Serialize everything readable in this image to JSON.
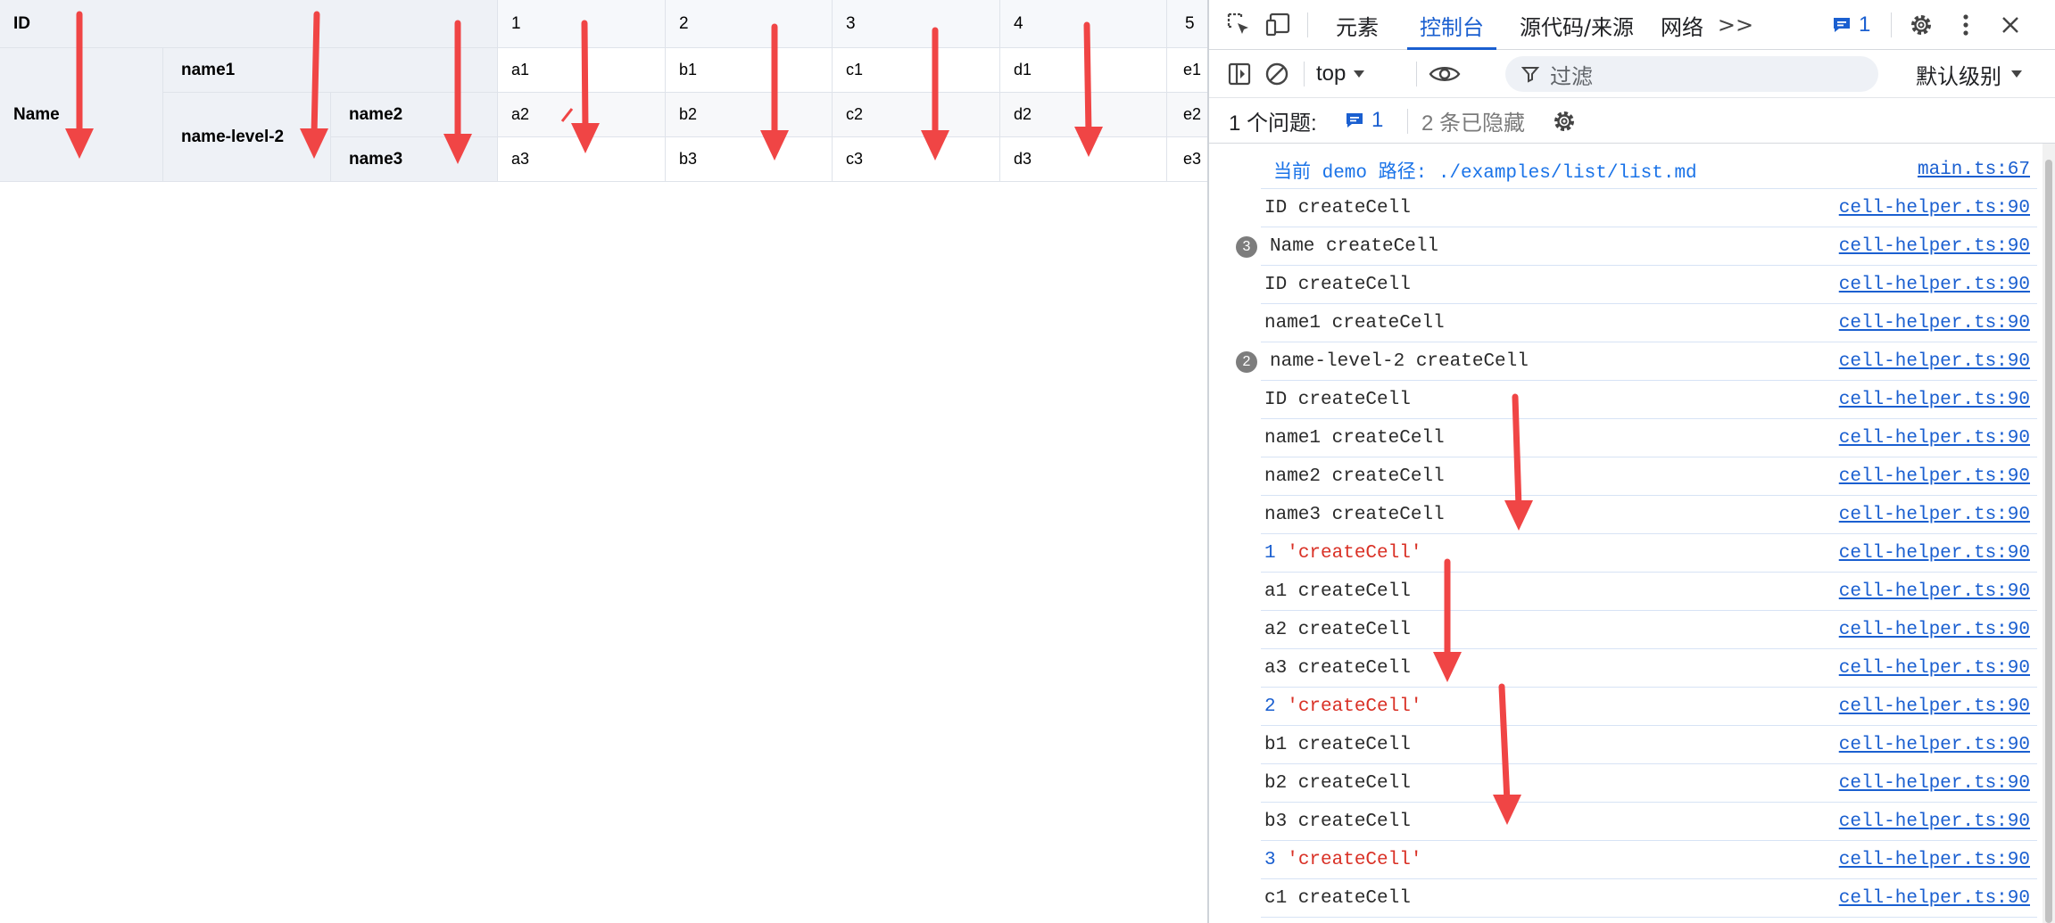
{
  "table": {
    "header_id": "ID",
    "row_header_name": "Name",
    "row_header_name1": "name1",
    "row_header_level2": "name-level-2",
    "row_header_name2": "name2",
    "row_header_name3": "name3",
    "columns": [
      "1",
      "2",
      "3",
      "4",
      "5"
    ],
    "rows": [
      [
        "a1",
        "b1",
        "c1",
        "d1",
        "e1"
      ],
      [
        "a2",
        "b2",
        "c2",
        "d2",
        "e2"
      ],
      [
        "a3",
        "b3",
        "c3",
        "d3",
        "e3"
      ]
    ]
  },
  "devtools": {
    "tabs": [
      "元素",
      "控制台",
      "源代码/来源",
      "网络"
    ],
    "active_tab": "控制台",
    "more_tabs": ">>",
    "messages_count": "1",
    "context": "top",
    "filter_placeholder": "过滤",
    "levels": "默认级别",
    "issues_label": "1 个问题:",
    "issues_count": "1",
    "hidden_label": "2 条已隐藏"
  },
  "console": [
    {
      "msg": "当前 demo 路径: ./examples/list/list.md",
      "src": "main.ts:67",
      "style": "info"
    },
    {
      "msg": "ID createCell",
      "src": "cell-helper.ts:90"
    },
    {
      "msg": "Name createCell",
      "src": "cell-helper.ts:90",
      "badge": "3"
    },
    {
      "msg": "ID createCell",
      "src": "cell-helper.ts:90"
    },
    {
      "msg": "name1 createCell",
      "src": "cell-helper.ts:90"
    },
    {
      "msg": "name-level-2 createCell",
      "src": "cell-helper.ts:90",
      "badge": "2"
    },
    {
      "msg": "ID createCell",
      "src": "cell-helper.ts:90"
    },
    {
      "msg": "name1 createCell",
      "src": "cell-helper.ts:90"
    },
    {
      "msg": "name2 createCell",
      "src": "cell-helper.ts:90"
    },
    {
      "msg": "name3 createCell",
      "src": "cell-helper.ts:90"
    },
    {
      "num": "1",
      "str": "'createCell'",
      "src": "cell-helper.ts:90"
    },
    {
      "msg": "a1 createCell",
      "src": "cell-helper.ts:90"
    },
    {
      "msg": "a2 createCell",
      "src": "cell-helper.ts:90"
    },
    {
      "msg": "a3 createCell",
      "src": "cell-helper.ts:90"
    },
    {
      "num": "2",
      "str": "'createCell'",
      "src": "cell-helper.ts:90"
    },
    {
      "msg": "b1 createCell",
      "src": "cell-helper.ts:90"
    },
    {
      "msg": "b2 createCell",
      "src": "cell-helper.ts:90"
    },
    {
      "msg": "b3 createCell",
      "src": "cell-helper.ts:90"
    },
    {
      "num": "3",
      "str": "'createCell'",
      "src": "cell-helper.ts:90"
    },
    {
      "msg": "c1 createCell",
      "src": "cell-helper.ts:90"
    }
  ],
  "colors": {
    "accent": "#1a5fd0",
    "annotation_arrow": "#f04545",
    "header_bg": "#eef1f6",
    "string_red": "#d93025"
  }
}
